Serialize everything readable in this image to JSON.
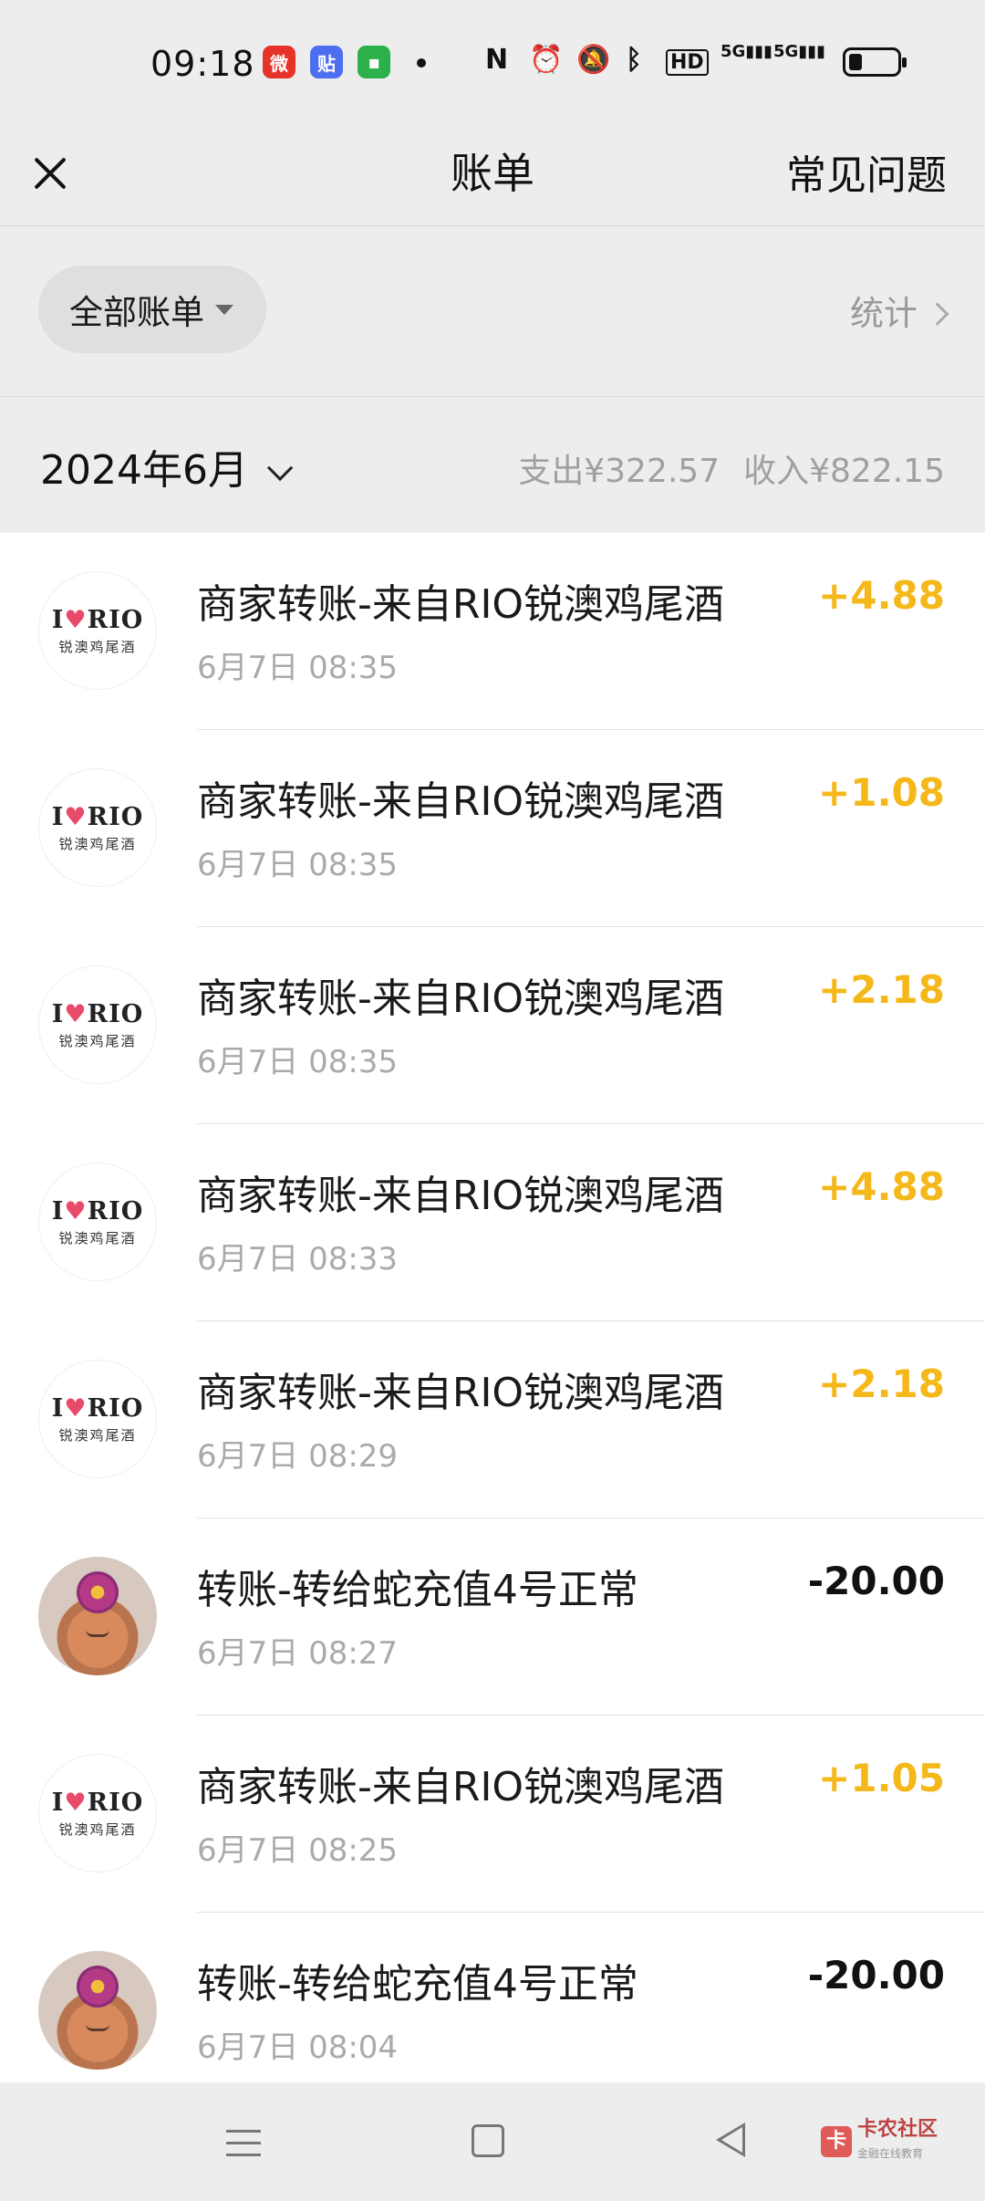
{
  "status_bar": {
    "time": "09:18",
    "apps": [
      {
        "icon": "weibo-icon",
        "color": "#e6332a"
      },
      {
        "icon": "tieba-icon",
        "color": "#4e6ef2"
      },
      {
        "icon": "messages-icon",
        "color": "#2cb14a"
      }
    ],
    "system_icons": [
      "nfc-icon",
      "alarm-icon",
      "mute-icon",
      "bluetooth-icon",
      "hd-icon",
      "signal-5g-icon",
      "signal-5g-icon",
      "battery-icon"
    ],
    "hd_label": "HD",
    "net_label_1": "5G",
    "net_label_2": "5G"
  },
  "header": {
    "title": "账单",
    "faq_label": "常见问题"
  },
  "filter": {
    "label": "全部账单",
    "stats_label": "统计"
  },
  "month": {
    "label": "2024年6月",
    "expense": "支出¥322.57",
    "income": "收入¥822.15"
  },
  "rio_logo": {
    "top": "IRIO",
    "sub": "锐澳鸡尾酒"
  },
  "transactions": [
    {
      "title": "商家转账-来自RIO锐澳鸡尾酒",
      "time": "6月7日 08:35",
      "amount": "+4.88",
      "type": "income",
      "avatar": "rio"
    },
    {
      "title": "商家转账-来自RIO锐澳鸡尾酒",
      "time": "6月7日 08:35",
      "amount": "+1.08",
      "type": "income",
      "avatar": "rio"
    },
    {
      "title": "商家转账-来自RIO锐澳鸡尾酒",
      "time": "6月7日 08:35",
      "amount": "+2.18",
      "type": "income",
      "avatar": "rio"
    },
    {
      "title": "商家转账-来自RIO锐澳鸡尾酒",
      "time": "6月7日 08:33",
      "amount": "+4.88",
      "type": "income",
      "avatar": "rio"
    },
    {
      "title": "商家转账-来自RIO锐澳鸡尾酒",
      "time": "6月7日 08:29",
      "amount": "+2.18",
      "type": "income",
      "avatar": "rio"
    },
    {
      "title": "转账-转给蛇充值4号正常",
      "time": "6月7日 08:27",
      "amount": "-20.00",
      "type": "expense",
      "avatar": "photo"
    },
    {
      "title": "商家转账-来自RIO锐澳鸡尾酒",
      "time": "6月7日 08:25",
      "amount": "+1.05",
      "type": "income",
      "avatar": "rio"
    },
    {
      "title": "转账-转给蛇充值4号正常",
      "time": "6月7日 08:04",
      "amount": "-20.00",
      "type": "expense",
      "avatar": "photo"
    }
  ],
  "colors": {
    "income": "#f5b81a",
    "expense": "#111111",
    "background": "#ededed"
  },
  "watermark": {
    "title": "卡农社区",
    "sub": "金融在线教育"
  }
}
